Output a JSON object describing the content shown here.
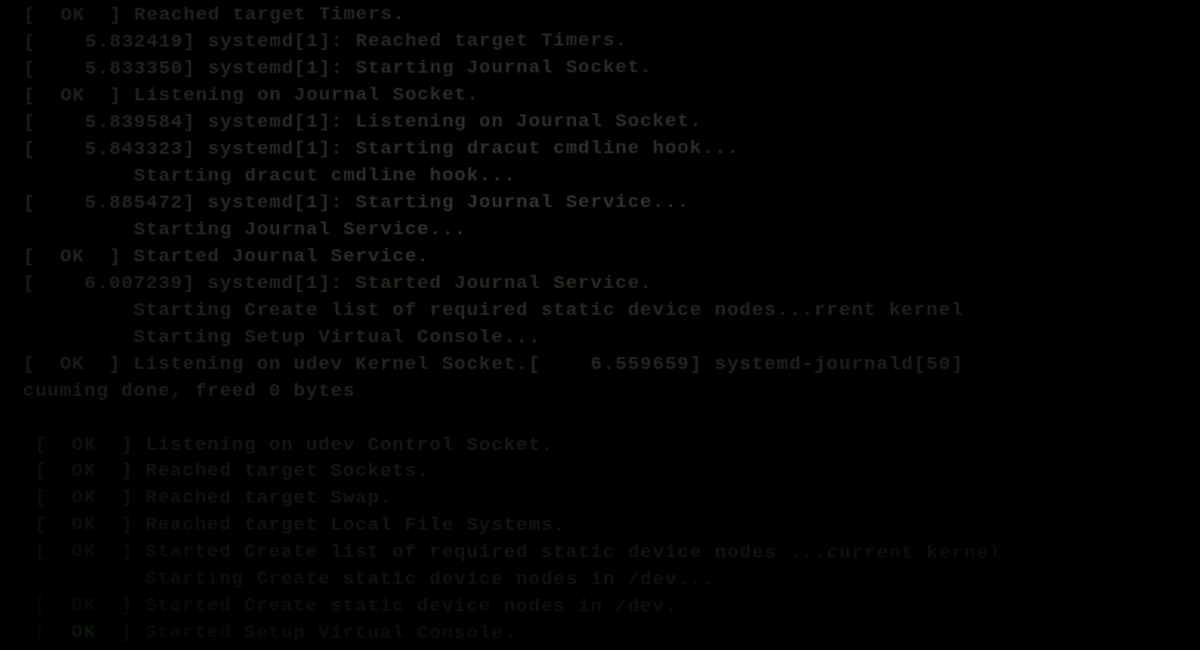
{
  "boot_log": {
    "lines": [
      {
        "text": "[  OK  ] Reached target Timers."
      },
      {
        "text": "[    5.832419] systemd[1]: Reached target Timers."
      },
      {
        "text": "[    5.833350] systemd[1]: Starting Journal Socket."
      },
      {
        "text": "[  OK  ] Listening on Journal Socket."
      },
      {
        "text": "[    5.839584] systemd[1]: Listening on Journal Socket."
      },
      {
        "text": "[    5.843323] systemd[1]: Starting dracut cmdline hook..."
      },
      {
        "text": "         Starting dracut cmdline hook..."
      },
      {
        "text": "[    5.885472] systemd[1]: Starting Journal Service..."
      },
      {
        "text": "         Starting Journal Service..."
      },
      {
        "text": "[  OK  ] Started Journal Service."
      },
      {
        "text": "[    6.007239] systemd[1]: Started Journal Service."
      },
      {
        "text": "         Starting Create list of required static device nodes...rrent kernel"
      },
      {
        "text": "         Starting Setup Virtual Console..."
      },
      {
        "text": "[  OK  ] Listening on udev Kernel Socket.[    6.559659] systemd-journald[50]"
      },
      {
        "text": "cuuming done, freed 0 bytes"
      },
      {
        "text": " "
      },
      {
        "text": " [  OK  ] Listening on udev Control Socket."
      },
      {
        "text": " [  OK  ] Reached target Sockets."
      },
      {
        "text": " [  OK  ] Reached target Swap."
      },
      {
        "text": " [  OK  ] Reached target Local File Systems."
      },
      {
        "text": " [  OK  ] Started Create list of required static device nodes ...current kernel"
      },
      {
        "text": "          Starting Create static device nodes in /dev..."
      },
      {
        "text": " [  OK  ] Started Create static device nodes in /dev."
      }
    ],
    "last_line": {
      "prefix": " [  ",
      "ok": "OK",
      "suffix": "  ] Started Setup Virtual Console."
    }
  }
}
